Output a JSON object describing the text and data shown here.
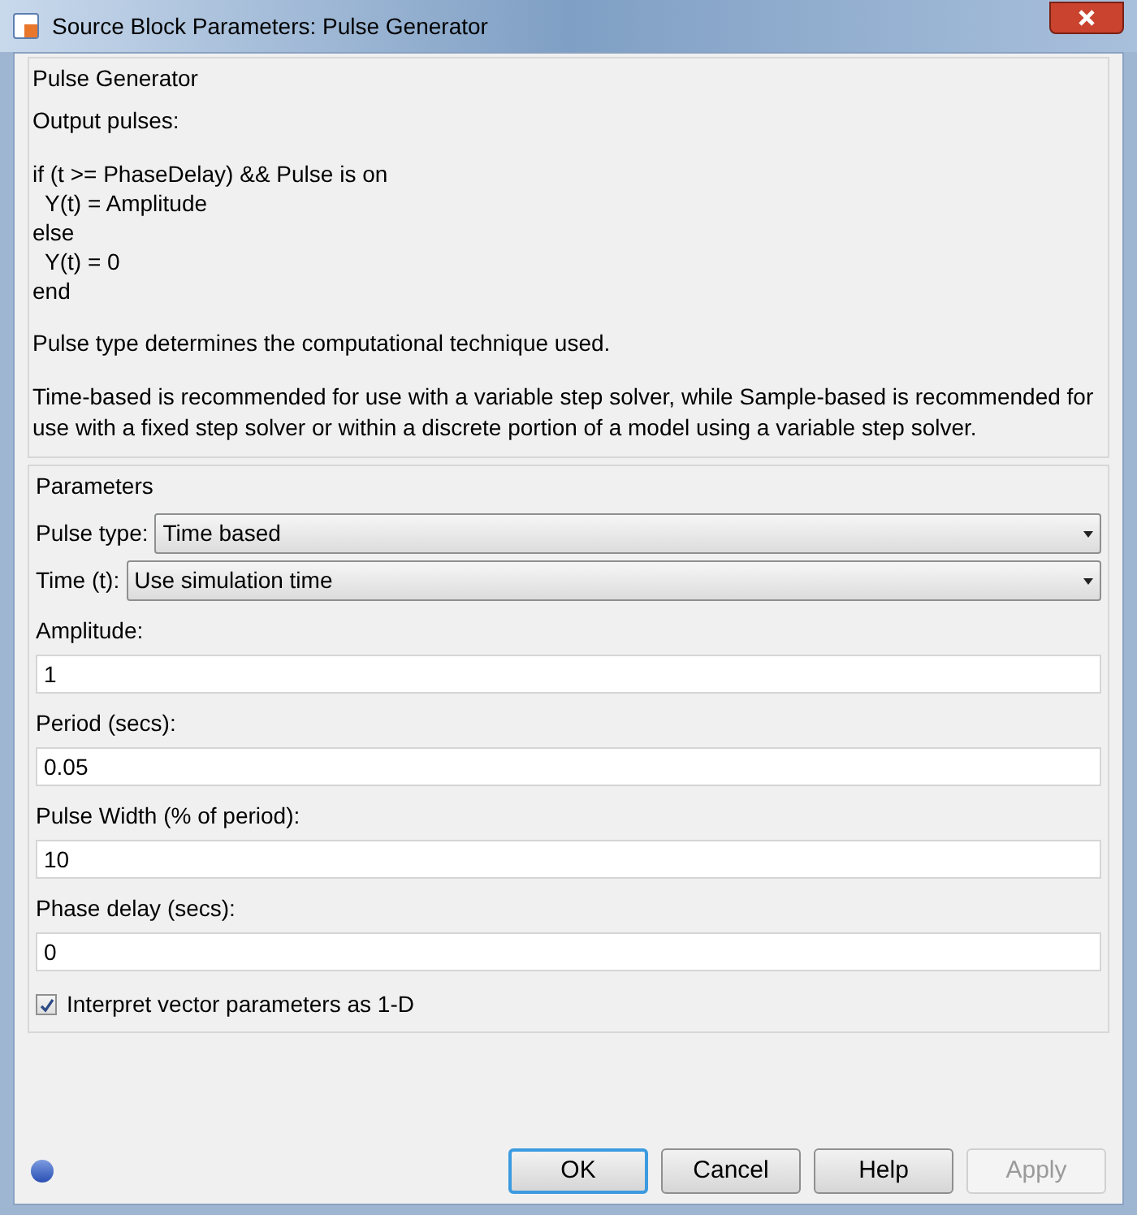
{
  "window": {
    "title": "Source Block Parameters: Pulse Generator"
  },
  "block": {
    "title": "Pulse Generator",
    "description": [
      {
        "kind": "text",
        "text": "Output pulses:"
      },
      {
        "kind": "code",
        "lines": [
          "if (t >= PhaseDelay) && Pulse is on",
          "  Y(t) = Amplitude",
          "else",
          "  Y(t) = 0",
          "end"
        ]
      },
      {
        "kind": "text",
        "text": "Pulse type determines the computational technique used."
      },
      {
        "kind": "text",
        "text": "Time-based is recommended for use with a variable step solver, while Sample-based is recommended for use with a fixed step solver or within a discrete portion of a model using a variable step solver."
      }
    ]
  },
  "parameters": {
    "title": "Parameters",
    "items": [
      {
        "kind": "dropdown",
        "label": "Pulse type:",
        "value": "Time based"
      },
      {
        "kind": "dropdown",
        "label": "Time (t):",
        "value": "Use simulation time"
      },
      {
        "kind": "field",
        "label": "Amplitude:",
        "value": "1"
      },
      {
        "kind": "field",
        "label": "Period (secs):",
        "value": "0.05"
      },
      {
        "kind": "field",
        "label": "Pulse Width (% of period):",
        "value": "10"
      },
      {
        "kind": "field",
        "label": "Phase delay (secs):",
        "value": "0"
      },
      {
        "kind": "checkbox",
        "label": "Interpret vector parameters as 1-D",
        "checked": true
      }
    ]
  },
  "buttons": [
    {
      "label": "OK",
      "default": true,
      "disabled": false
    },
    {
      "label": "Cancel",
      "default": false,
      "disabled": false
    },
    {
      "label": "Help",
      "default": false,
      "disabled": false
    },
    {
      "label": "Apply",
      "default": false,
      "disabled": true
    }
  ]
}
